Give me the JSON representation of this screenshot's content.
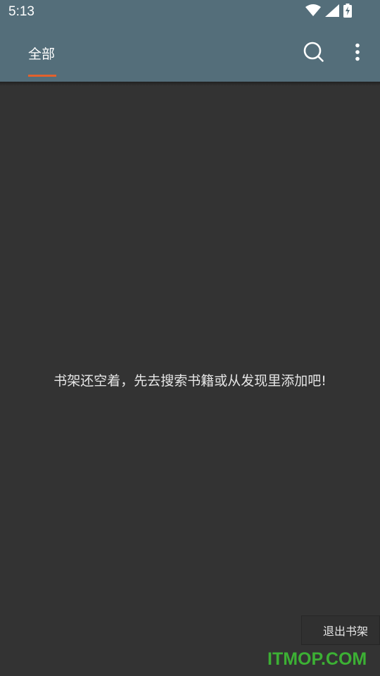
{
  "status_bar": {
    "time": "5:13",
    "icons": [
      "wifi-icon",
      "cell-signal-icon",
      "battery-charging-icon"
    ]
  },
  "app_bar": {
    "tabs": [
      {
        "label": "全部",
        "selected": true
      }
    ],
    "actions": [
      "search-icon",
      "more-vert-icon"
    ],
    "accent_color": "#E3612C",
    "background_color": "#546E7A"
  },
  "bookshelf": {
    "empty_message": "书架还空着，先去搜索书籍或从发现里添加吧!",
    "exit_label": "退出书架",
    "background_color": "#333333"
  },
  "watermark": {
    "text": "ITMOP.COM",
    "color": "#3CB034"
  }
}
